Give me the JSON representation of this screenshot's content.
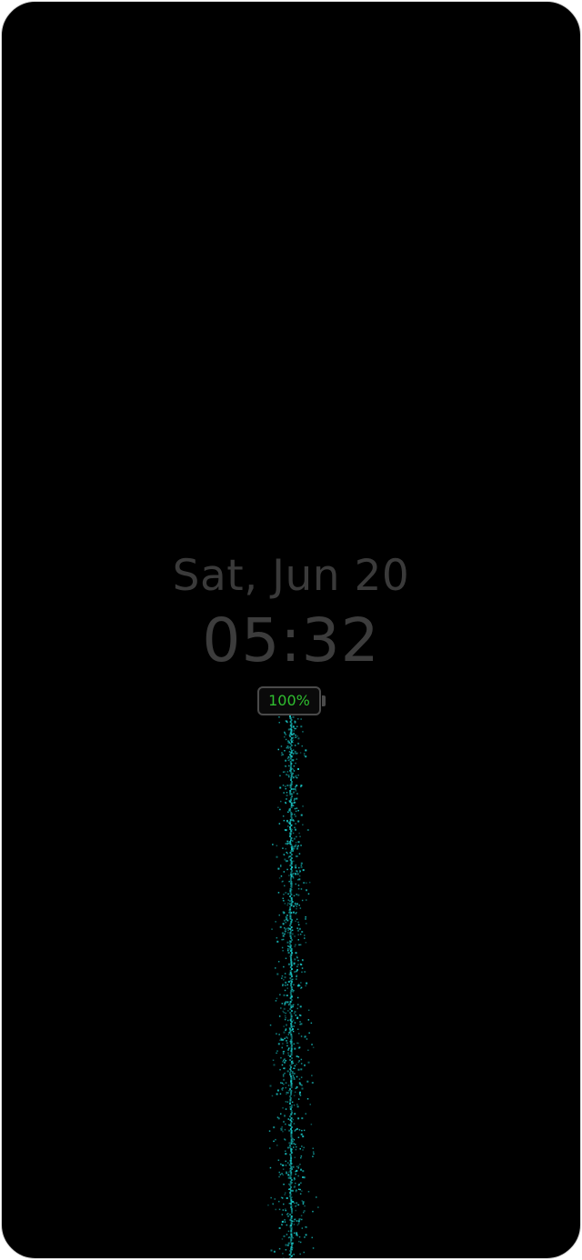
{
  "lockscreen": {
    "date": "Sat, Jun 20",
    "time": "05:32",
    "battery": {
      "label": "100%",
      "level": 1.0
    }
  },
  "colors": {
    "background": "#000000",
    "text": "#3b3b3b",
    "battery_text": "#2fbf2f",
    "particles": "#19c6c6"
  }
}
